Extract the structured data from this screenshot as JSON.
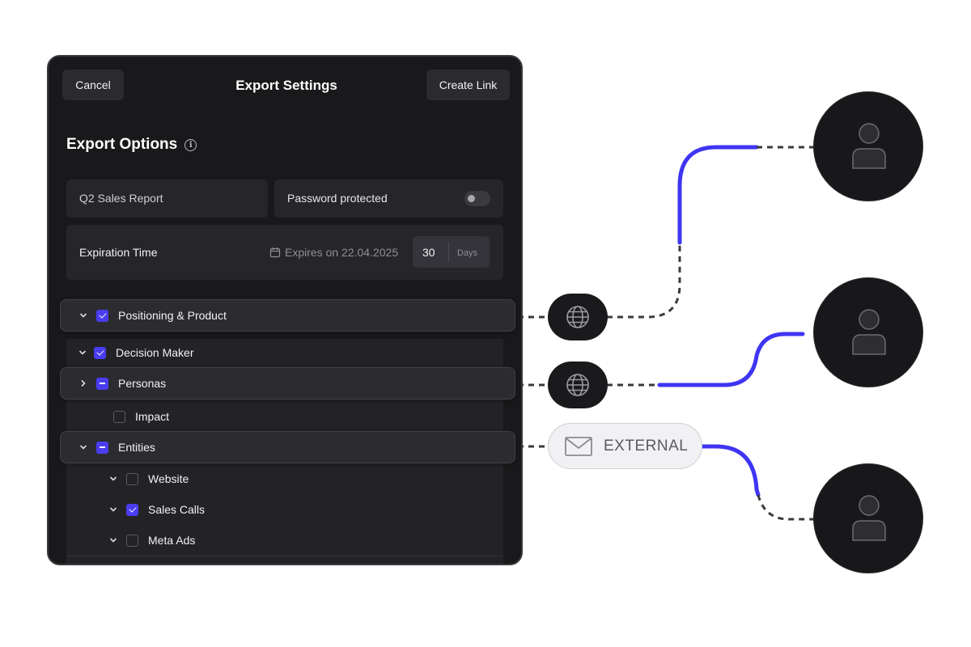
{
  "header": {
    "cancel_label": "Cancel",
    "title": "Export Settings",
    "create_label": "Create Link"
  },
  "options": {
    "title": "Export Options",
    "info_icon": "info-icon",
    "report_name": "Q2 Sales Report",
    "password_label": "Password protected",
    "password_enabled": false,
    "expiration_label": "Expiration Time",
    "expires_text": "Expires on 22.04.2025",
    "days_value": "30",
    "days_unit": "Days"
  },
  "tree": {
    "positioning": {
      "label": "Positioning & Product",
      "state": "checked",
      "expanded": true
    },
    "decision_maker": {
      "label": "Decision Maker",
      "state": "checked",
      "expanded": true
    },
    "personas": {
      "label": "Personas",
      "state": "partial",
      "expanded": false
    },
    "impact": {
      "label": "Impact",
      "state": "unchecked"
    },
    "entities": {
      "label": "Entities",
      "state": "partial",
      "expanded": true
    },
    "website": {
      "label": "Website",
      "state": "unchecked",
      "expanded": true
    },
    "sales_calls": {
      "label": "Sales Calls",
      "state": "checked",
      "expanded": true
    },
    "meta_ads": {
      "label": "Meta Ads",
      "state": "unchecked",
      "expanded": true
    }
  },
  "share": {
    "globe_icon": "globe-icon",
    "mail_icon": "mail-icon",
    "external_label": "EXTERNAL",
    "user_icon": "user-icon"
  },
  "colors": {
    "accent": "#4a3cf0",
    "panel_bg": "#19191b",
    "connector_blue": "#3f35f2",
    "connector_dots": "#3a3a3e"
  }
}
